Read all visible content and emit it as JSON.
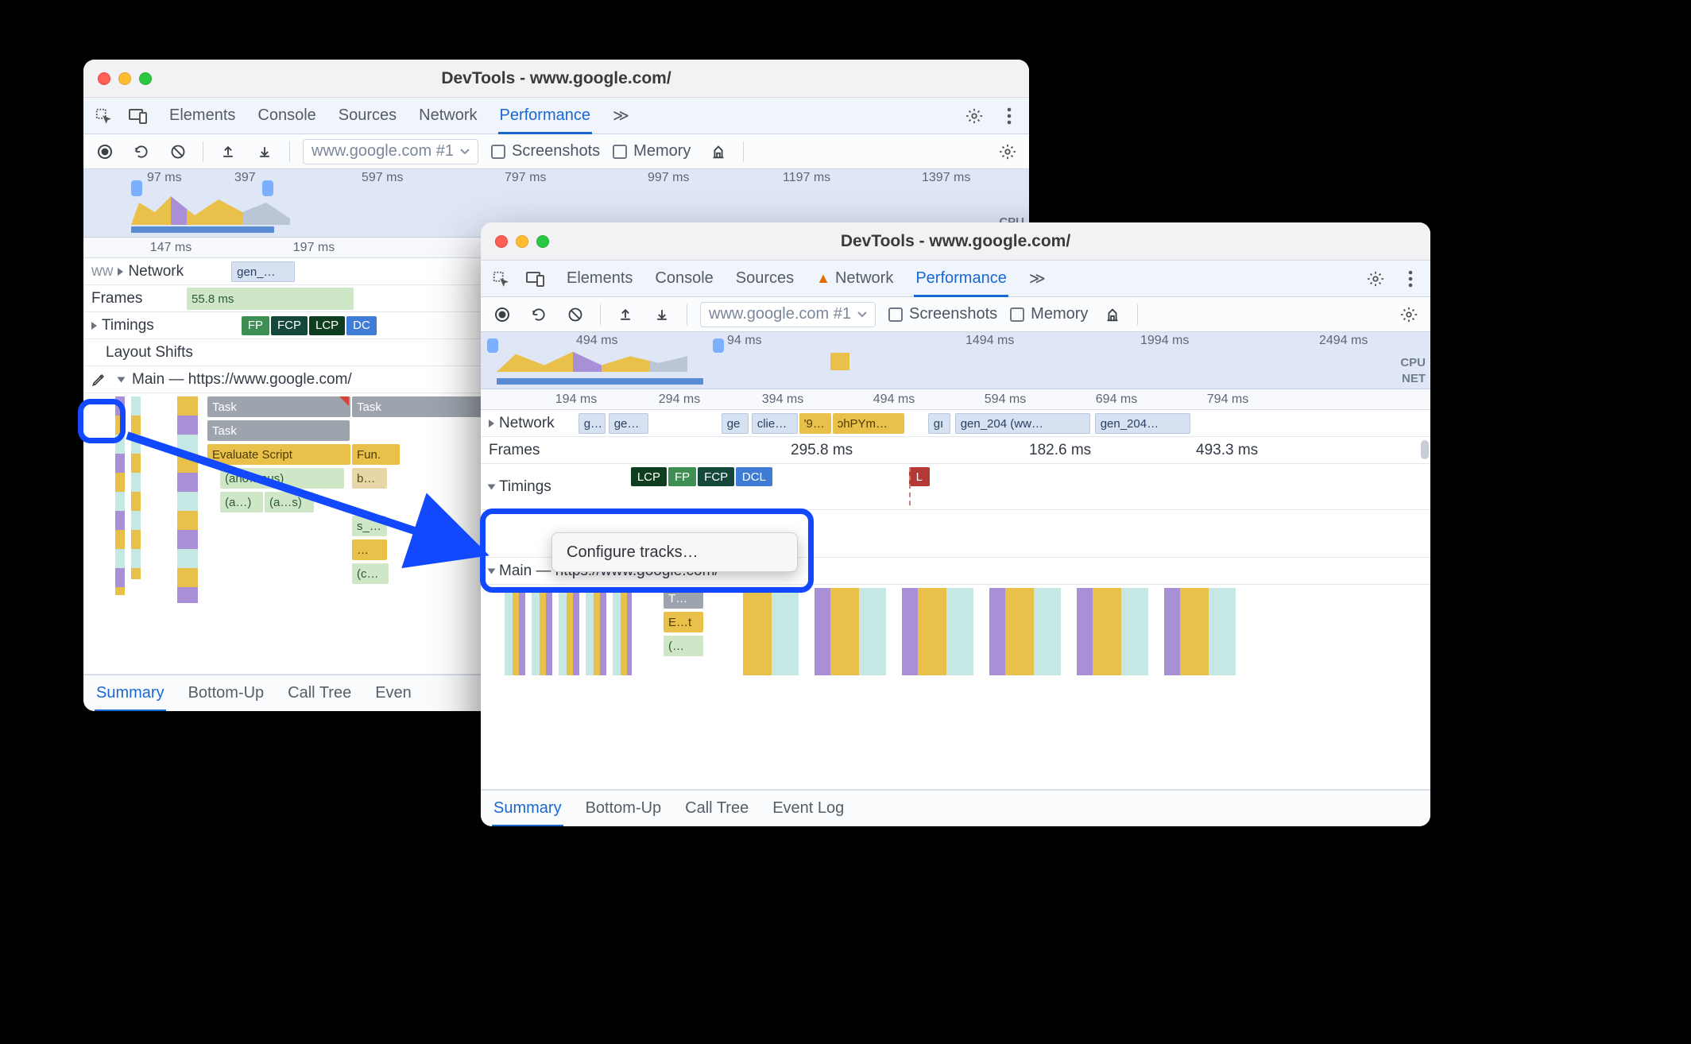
{
  "window_a": {
    "title": "DevTools - www.google.com/",
    "tabs": [
      "Elements",
      "Console",
      "Sources",
      "Network",
      "Performance"
    ],
    "active_tab": "Performance",
    "more_glyph": "≫",
    "toolbar": {
      "profile_label": "www.google.com #1",
      "screenshots_label": "Screenshots",
      "memory_label": "Memory"
    },
    "overview_ticks": [
      "97 ms",
      "397",
      "597 ms",
      "797 ms",
      "997 ms",
      "1197 ms",
      "1397 ms"
    ],
    "overview_cpu": "CPU",
    "ruler_ticks": [
      "147 ms",
      "197 ms"
    ],
    "tracks": {
      "ww_label": "ww",
      "network_label": "Network",
      "network_chip": "gen_…",
      "frames_label": "Frames",
      "frames_value": "55.8 ms",
      "timings_label": "Timings",
      "timings_chips": [
        "FP",
        "FCP",
        "LCP",
        "DC"
      ],
      "layout_shifts_label": "Layout Shifts",
      "main_label": "Main — https://www.google.com/"
    },
    "flame_labels": {
      "task_a": "Task",
      "task_b": "Task",
      "eval": "Evaluate Script",
      "fun": "Fun.",
      "anon_a": "(ano…ous)",
      "anon_b": "(a…)",
      "anon_c": "(a…s)",
      "s": "s_…",
      "dots": "…",
      "c": "(c…",
      "b": "b…"
    },
    "bottom_tabs": [
      "Summary",
      "Bottom-Up",
      "Call Tree",
      "Even"
    ]
  },
  "window_b": {
    "title": "DevTools - www.google.com/",
    "tabs": [
      "Elements",
      "Console",
      "Sources",
      "Network",
      "Performance"
    ],
    "network_has_warning": true,
    "active_tab": "Performance",
    "more_glyph": "≫",
    "toolbar": {
      "profile_label": "www.google.com #1",
      "screenshots_label": "Screenshots",
      "memory_label": "Memory"
    },
    "overview_ticks": [
      "494 ms",
      "94 ms",
      "1494 ms",
      "1994 ms",
      "2494 ms"
    ],
    "overview_cpu": "CPU",
    "overview_net": "NET",
    "ruler_ticks": [
      "194 ms",
      "294 ms",
      "394 ms",
      "494 ms",
      "594 ms",
      "694 ms",
      "794 ms"
    ],
    "tracks": {
      "network_label": "Network",
      "network_chips": [
        "g…",
        "ge…",
        "ge",
        "clie…",
        "'9…",
        "ɔhPYm…",
        "gı",
        "gen_204 (ww…",
        "gen_204…"
      ],
      "frames_label": "Frames",
      "frames_values": [
        "295.8 ms",
        "182.6 ms",
        "493.3 ms"
      ],
      "timings_label": "Timings",
      "timings_chips": [
        "LCP",
        "FP",
        "FCP",
        "DCL"
      ],
      "timings_badge": "L",
      "main_label": "Main — https://www.google.com/",
      "flame_t": "T…",
      "flame_e": "E…t",
      "flame_paren": "(…"
    },
    "bottom_tabs": [
      "Summary",
      "Bottom-Up",
      "Call Tree",
      "Event Log"
    ],
    "context_menu": "Configure tracks…"
  }
}
